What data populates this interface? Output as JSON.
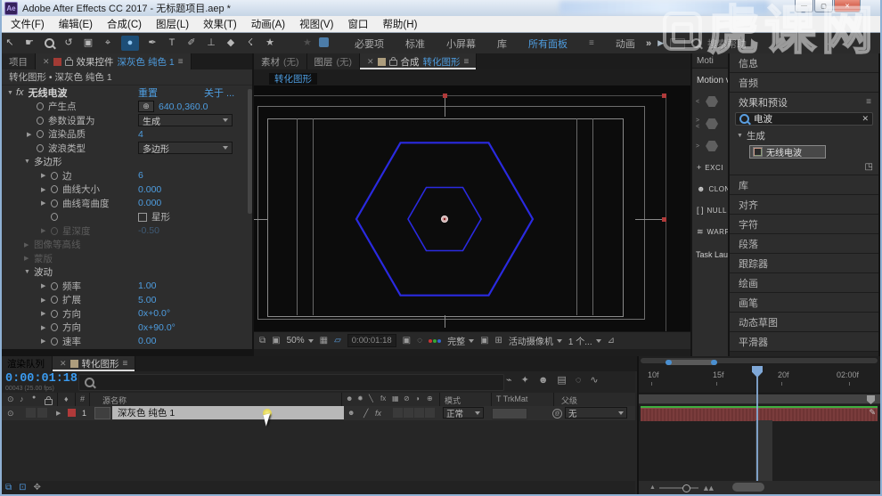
{
  "window": {
    "title": "Adobe After Effects CC 2017 - 无标题项目.aep *",
    "logo": "Ae",
    "minimize": "—",
    "maximize": "▢",
    "close": "✕"
  },
  "menu": {
    "items": [
      "文件(F)",
      "编辑(E)",
      "合成(C)",
      "图层(L)",
      "效果(T)",
      "动画(A)",
      "视图(V)",
      "窗口",
      "帮助(H)"
    ]
  },
  "toolbar": {
    "tools": [
      {
        "name": "selection-tool-icon",
        "glyph": "↖"
      },
      {
        "name": "hand-tool-icon",
        "glyph": "☛"
      },
      {
        "name": "zoom-tool-icon",
        "glyph": "",
        "cls": "magt"
      },
      {
        "name": "rotate-tool-icon",
        "glyph": "↺"
      },
      {
        "name": "camera-tool-icon",
        "glyph": "▣"
      },
      {
        "name": "pan-behind-tool-icon",
        "glyph": "⌖"
      },
      {
        "name": "shape-tool-icon",
        "glyph": "●",
        "cls": "active"
      },
      {
        "name": "pen-tool-icon",
        "glyph": "✒"
      },
      {
        "name": "type-tool-icon",
        "glyph": "T"
      },
      {
        "name": "brush-tool-icon",
        "glyph": "✐"
      },
      {
        "name": "clone-stamp-tool-icon",
        "glyph": "⊥"
      },
      {
        "name": "eraser-tool-icon",
        "glyph": "◆"
      },
      {
        "name": "roto-brush-tool-icon",
        "glyph": "☇"
      },
      {
        "name": "puppet-pin-tool-icon",
        "glyph": "★"
      }
    ],
    "star_icon": "★",
    "workspaces": [
      {
        "label": "必要项"
      },
      {
        "label": "标准"
      },
      {
        "label": "小屏幕"
      },
      {
        "label": "库"
      },
      {
        "label": "所有面板",
        "cls": "active"
      }
    ],
    "panel_menu_icon": "≡",
    "workspace_last": "动画",
    "overflow_icon": "»",
    "media_icon": "▶",
    "search_label": "搜索帮助"
  },
  "effect_controls": {
    "project_tab": "项目",
    "close_icon": "✕",
    "tab_title": "效果控件",
    "tab_layer": "深灰色 纯色 1",
    "menu_icon": "≡",
    "breadcrumb": "转化图形 • 深灰色 纯色 1",
    "effect": {
      "arrow": "▼",
      "fx": "fx",
      "name": "无线电波",
      "reset": "重置",
      "about": "关于 ..."
    },
    "rows": [
      {
        "cls": "lv0",
        "sw": 1,
        "xhair": 1,
        "label": "产生点",
        "value": "640.0,360.0"
      },
      {
        "cls": "lv0",
        "sw": 1,
        "label": "参数设置为",
        "dd": 1,
        "ddvalue": "生成"
      },
      {
        "cls": "lv0",
        "arrow": "▶",
        "sw": 1,
        "label": "渲染品质",
        "value": "4"
      },
      {
        "cls": "lv0",
        "sw": 1,
        "label": "波浪类型",
        "dd": 1,
        "ddvalue": "多边形"
      },
      {
        "cls": "g",
        "arrow": "▼",
        "label": "多边形"
      },
      {
        "cls": "lv1",
        "arrow": "▶",
        "sw": 1,
        "label": "边",
        "value": "6"
      },
      {
        "cls": "lv1",
        "arrow": "▶",
        "sw": 1,
        "label": "曲线大小",
        "value": "0.000"
      },
      {
        "cls": "lv1",
        "arrow": "▶",
        "sw": 1,
        "label": "曲线弯曲度",
        "value": "0.000"
      },
      {
        "cls": "lv1 chkrow",
        "sw": 1,
        "chk": 1,
        "value": "星形"
      },
      {
        "cls": "lv1 dim",
        "arrow": "▶",
        "sw": 1,
        "label": "星深度",
        "value": "-0.50"
      },
      {
        "cls": "g dim",
        "arrow": "▶",
        "label": "图像等高线"
      },
      {
        "cls": "g dim",
        "arrow": "▶",
        "label": "蒙版"
      },
      {
        "cls": "g",
        "arrow": "▼",
        "label": "波动"
      },
      {
        "cls": "lv1",
        "arrow": "▶",
        "sw": 1,
        "label": "频率",
        "value": "1.00"
      },
      {
        "cls": "lv1",
        "arrow": "▶",
        "sw": 1,
        "label": "扩展",
        "value": "5.00"
      },
      {
        "cls": "lv1",
        "arrow": "▶",
        "sw": 1,
        "label": "方向",
        "value": "0x+0.0°"
      },
      {
        "cls": "lv1",
        "arrow": "▶",
        "sw": 1,
        "label": "方向",
        "value": "0x+90.0°"
      },
      {
        "cls": "lv1",
        "arrow": "▶",
        "sw": 1,
        "label": "速率",
        "value": "0.00"
      }
    ]
  },
  "viewer": {
    "tab_footage": "素材",
    "tab_footage_none": "(无)",
    "tab_layer": "图层",
    "tab_layer_none": "(无)",
    "close_icon": "✕",
    "tab_comp_prefix": "合成",
    "tab_comp_name": "转化图形",
    "menu_icon": "≡",
    "chip": "转化图形",
    "toolbar": {
      "zoom": "50%",
      "timecode": "0:00:01:18",
      "resolution": "完整",
      "camera": "活动摄像机",
      "views": "1 个..."
    }
  },
  "motion_panel": {
    "tab": "Moti",
    "header": "Motion v",
    "anchors": [
      {
        "pre": "<"
      },
      {
        "pre": "><"
      },
      {
        "pre": ">"
      }
    ],
    "buttons": [
      {
        "icon": "+",
        "label": "EXCI",
        "name": "excite-button"
      },
      {
        "icon": "☻",
        "label": "CLON",
        "name": "cloner-button"
      },
      {
        "icon": "[ ]",
        "label": "NULL",
        "name": "null-button"
      },
      {
        "icon": "≋",
        "label": "WARP",
        "name": "warp-button"
      }
    ],
    "task": "Task Lau"
  },
  "right_panels": {
    "above": [
      {
        "label": "信息"
      },
      {
        "label": "音频"
      }
    ],
    "effects_presets": {
      "title": "效果和预设",
      "menu_icon": "≡",
      "search_value": "电波",
      "clear_icon": "✕",
      "group_arrow": "▼",
      "group": "生成",
      "item": "无线电波",
      "corner_icon": "◳"
    },
    "below": [
      {
        "label": "库"
      },
      {
        "label": "对齐"
      },
      {
        "label": "字符"
      },
      {
        "label": "段落"
      },
      {
        "label": "跟踪器"
      },
      {
        "label": "绘画"
      },
      {
        "label": "画笔"
      },
      {
        "label": "动态草图"
      },
      {
        "label": "平滑器"
      }
    ]
  },
  "timeline": {
    "tab_queue": "渲染队列",
    "close_icon": "✕",
    "tab_comp": "转化图形",
    "menu_icon": "≡",
    "timecode": "0:00:01:18",
    "frames": "00043 (25.00 fps)",
    "tool_icons": [
      {
        "name": "mini-flowchart-icon",
        "glyph": "⌁"
      },
      {
        "name": "draft-3d-icon",
        "glyph": "✦"
      },
      {
        "name": "shy-toggle-icon",
        "glyph": "☻"
      },
      {
        "name": "frame-blend-toggle-icon",
        "glyph": "▤"
      },
      {
        "name": "motion-blur-toggle-icon",
        "glyph": "◌"
      },
      {
        "name": "graph-editor-icon",
        "glyph": "∿"
      }
    ],
    "av_icons": [
      {
        "name": "video-column-icon",
        "glyph": "⊙"
      },
      {
        "name": "audio-column-icon",
        "glyph": "♪"
      },
      {
        "name": "solo-column-icon",
        "glyph": "●"
      }
    ],
    "tag_icon": "♦",
    "hash": "#",
    "columns": {
      "source": "源名称",
      "mode": "模式",
      "trkmat": "T TrkMat",
      "parent": "父级"
    },
    "switch_icons": [
      {
        "name": "shy-column-icon",
        "glyph": "☻"
      },
      {
        "name": "collapse-column-icon",
        "glyph": "✹"
      },
      {
        "name": "quality-column-icon",
        "glyph": "╲"
      },
      {
        "name": "fx-column-icon",
        "glyph": "fx"
      },
      {
        "name": "frame-blend-column-icon",
        "glyph": "▦"
      },
      {
        "name": "motion-blur-column-icon",
        "glyph": "⊘"
      },
      {
        "name": "adjustment-column-icon",
        "glyph": "◑"
      },
      {
        "name": "3d-column-icon",
        "glyph": "⊕"
      }
    ],
    "layer": {
      "eye": "⊙",
      "expand": "▶",
      "index": "1",
      "name": "深灰色 纯色 1",
      "shy": "☻",
      "quality": "╱",
      "fx": "fx",
      "mode": "正常",
      "parent_link": "@",
      "parent": "无"
    },
    "ruler": [
      {
        "label": "10f"
      },
      {
        "label": "15f"
      },
      {
        "label": "20f"
      },
      {
        "label": "02:00f"
      }
    ],
    "marker_pen_icon": "✎",
    "bottom_icons": [
      {
        "name": "timeline-pane-toggle-icon-1",
        "glyph": "⧉"
      },
      {
        "name": "timeline-pane-toggle-icon-2",
        "glyph": "⊡"
      },
      {
        "name": "timeline-pane-toggle-icon-3",
        "glyph": "✥",
        "cls": "gray"
      }
    ],
    "zoom_out_icon": "▲",
    "zoom_in_icon": "▲▲"
  },
  "watermark": {
    "text": "虎课网"
  },
  "colors": {
    "accent_blue": "#4e9de0",
    "hexagon_blue": "#2a2ae0",
    "layer_red": "#b03a3a",
    "duration_green": "#3fae3f",
    "duration_maroon": "#7a3c3c",
    "selection_gray": "#b8b8b8",
    "timecode_blue": "#3a9bf0"
  }
}
